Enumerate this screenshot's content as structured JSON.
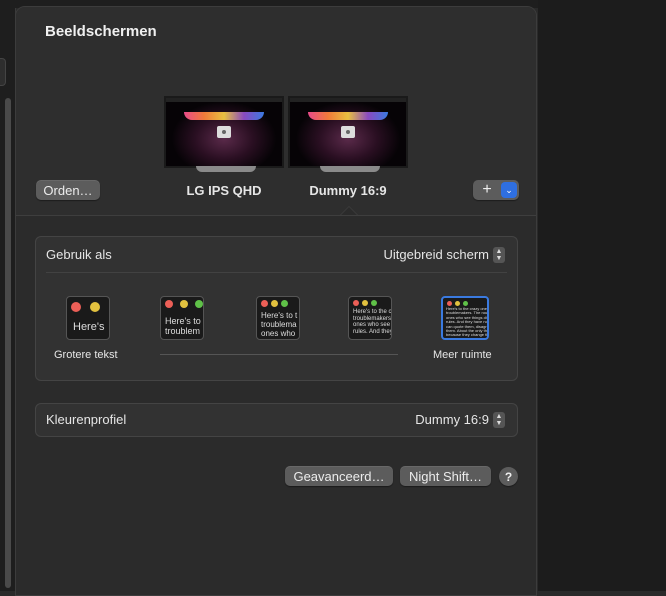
{
  "window": {
    "title": "Beeldschermen"
  },
  "arrangement": {
    "arrange_button": "Orden…",
    "add_button": "+",
    "add_menu_chevron": "⌄",
    "displays": [
      {
        "name": "LG IPS QHD",
        "icon": "monitor-icon"
      },
      {
        "name": "Dummy 16:9",
        "icon": "monitor-icon",
        "selected": true
      }
    ]
  },
  "use_as": {
    "label": "Gebruik als",
    "value": "Uitgebreid scherm",
    "resolution_options": [
      {
        "preview_text": "Here's",
        "caption": "Grotere tekst"
      },
      {
        "preview_text": "Here's to\ntroublem",
        "caption": ""
      },
      {
        "preview_text": "Here's to t\ntroublema\nones who",
        "caption": ""
      },
      {
        "preview_text": "Here's to the c\ntroublemakers.\nones who see t\nrules. And they",
        "caption": ""
      },
      {
        "preview_text": "Here's to the crazy ones\ntroublemakers. The rou\nones who see things diff\nrules. And they have no\ncan quote them, disagre\nthem. About the only thi\nbecause they change thi",
        "caption": "Meer ruimte",
        "selected": true
      }
    ]
  },
  "color_profile": {
    "label": "Kleurenprofiel",
    "value": "Dummy 16:9"
  },
  "footer": {
    "advanced_button": "Geavanceerd…",
    "night_shift_button": "Night Shift…",
    "help_button": "?"
  },
  "colors": {
    "accent": "#2f6fe0",
    "traffic_red": "#ec5f57",
    "traffic_yellow": "#e2c13f",
    "traffic_green": "#5fc148"
  }
}
